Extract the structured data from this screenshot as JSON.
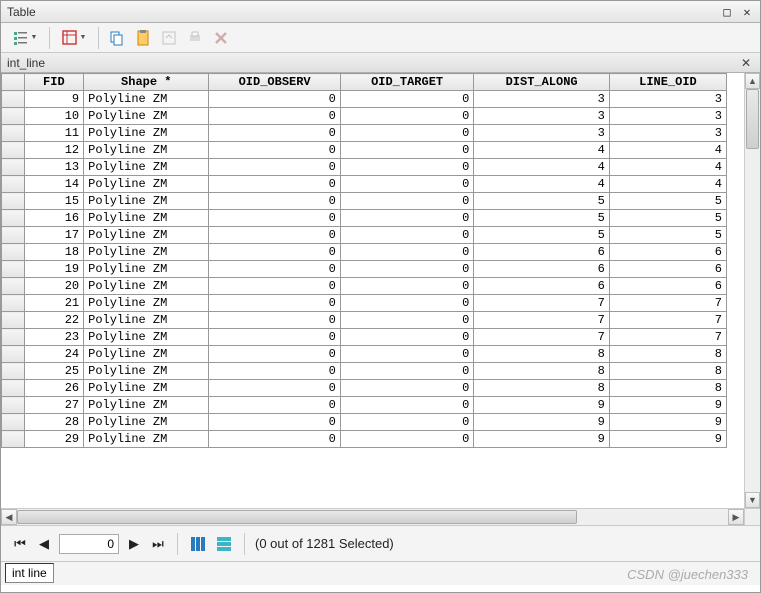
{
  "window": {
    "title": "Table",
    "maximize_sym": "□",
    "close_sym": "✕"
  },
  "subheader": {
    "title": "int_line",
    "close_sym": "✕"
  },
  "toolbar": {
    "icons": [
      "list-menu",
      "table-options",
      "copy-table",
      "paste-table",
      "export",
      "print",
      "delete"
    ]
  },
  "columns": {
    "rowsel": "",
    "fid": "FID",
    "shape": "Shape *",
    "obs": "OID_OBSERV",
    "tgt": "OID_TARGET",
    "dist": "DIST_ALONG",
    "lineoid": "LINE_OID"
  },
  "rows": [
    {
      "fid": 9,
      "shape": "Polyline ZM",
      "obs": 0,
      "tgt": 0,
      "dist": 3,
      "lineoid": 3
    },
    {
      "fid": 10,
      "shape": "Polyline ZM",
      "obs": 0,
      "tgt": 0,
      "dist": 3,
      "lineoid": 3
    },
    {
      "fid": 11,
      "shape": "Polyline ZM",
      "obs": 0,
      "tgt": 0,
      "dist": 3,
      "lineoid": 3
    },
    {
      "fid": 12,
      "shape": "Polyline ZM",
      "obs": 0,
      "tgt": 0,
      "dist": 4,
      "lineoid": 4
    },
    {
      "fid": 13,
      "shape": "Polyline ZM",
      "obs": 0,
      "tgt": 0,
      "dist": 4,
      "lineoid": 4
    },
    {
      "fid": 14,
      "shape": "Polyline ZM",
      "obs": 0,
      "tgt": 0,
      "dist": 4,
      "lineoid": 4
    },
    {
      "fid": 15,
      "shape": "Polyline ZM",
      "obs": 0,
      "tgt": 0,
      "dist": 5,
      "lineoid": 5
    },
    {
      "fid": 16,
      "shape": "Polyline ZM",
      "obs": 0,
      "tgt": 0,
      "dist": 5,
      "lineoid": 5
    },
    {
      "fid": 17,
      "shape": "Polyline ZM",
      "obs": 0,
      "tgt": 0,
      "dist": 5,
      "lineoid": 5
    },
    {
      "fid": 18,
      "shape": "Polyline ZM",
      "obs": 0,
      "tgt": 0,
      "dist": 6,
      "lineoid": 6
    },
    {
      "fid": 19,
      "shape": "Polyline ZM",
      "obs": 0,
      "tgt": 0,
      "dist": 6,
      "lineoid": 6
    },
    {
      "fid": 20,
      "shape": "Polyline ZM",
      "obs": 0,
      "tgt": 0,
      "dist": 6,
      "lineoid": 6
    },
    {
      "fid": 21,
      "shape": "Polyline ZM",
      "obs": 0,
      "tgt": 0,
      "dist": 7,
      "lineoid": 7
    },
    {
      "fid": 22,
      "shape": "Polyline ZM",
      "obs": 0,
      "tgt": 0,
      "dist": 7,
      "lineoid": 7
    },
    {
      "fid": 23,
      "shape": "Polyline ZM",
      "obs": 0,
      "tgt": 0,
      "dist": 7,
      "lineoid": 7
    },
    {
      "fid": 24,
      "shape": "Polyline ZM",
      "obs": 0,
      "tgt": 0,
      "dist": 8,
      "lineoid": 8
    },
    {
      "fid": 25,
      "shape": "Polyline ZM",
      "obs": 0,
      "tgt": 0,
      "dist": 8,
      "lineoid": 8
    },
    {
      "fid": 26,
      "shape": "Polyline ZM",
      "obs": 0,
      "tgt": 0,
      "dist": 8,
      "lineoid": 8
    },
    {
      "fid": 27,
      "shape": "Polyline ZM",
      "obs": 0,
      "tgt": 0,
      "dist": 9,
      "lineoid": 9
    },
    {
      "fid": 28,
      "shape": "Polyline ZM",
      "obs": 0,
      "tgt": 0,
      "dist": 9,
      "lineoid": 9
    },
    {
      "fid": 29,
      "shape": "Polyline ZM",
      "obs": 0,
      "tgt": 0,
      "dist": 9,
      "lineoid": 9
    }
  ],
  "nav": {
    "first": "⏮",
    "prev": "◀",
    "next": "▶",
    "last": "⏭",
    "pos": "0",
    "status": "(0 out of 1281 Selected)"
  },
  "tab": {
    "label": "int line"
  },
  "watermark": "CSDN @juechen333"
}
